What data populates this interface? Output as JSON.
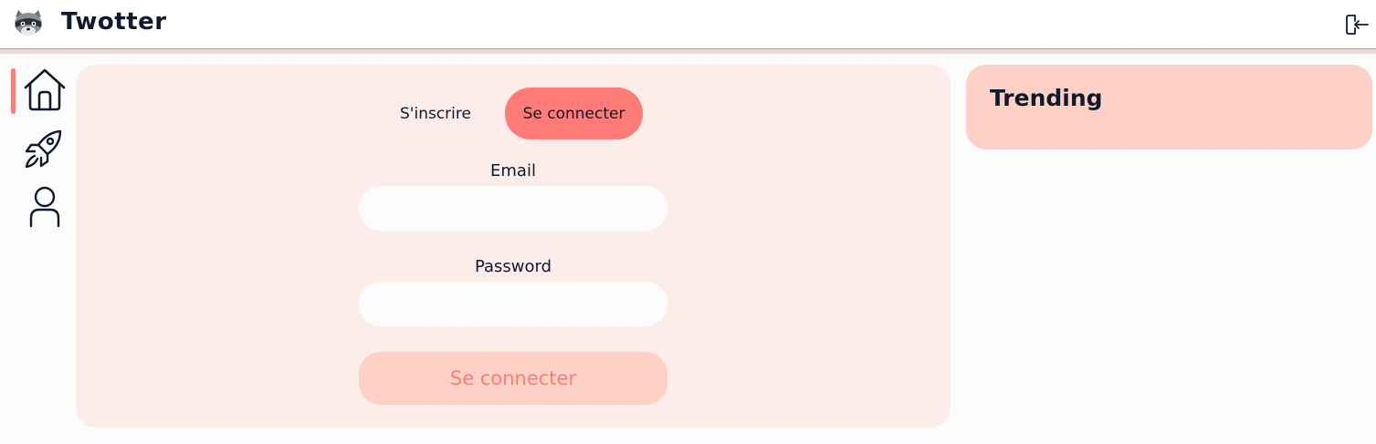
{
  "app": {
    "title": "Twotter",
    "logo_icon": "raccoon-icon",
    "logout_icon": "logout-icon"
  },
  "nav": {
    "items": [
      {
        "name": "home",
        "icon": "home-icon",
        "active": true
      },
      {
        "name": "explore",
        "icon": "rocket-icon",
        "active": false
      },
      {
        "name": "profile",
        "icon": "user-icon",
        "active": false
      }
    ]
  },
  "auth": {
    "tabs": {
      "signup_label": "S'inscrire",
      "login_label": "Se connecter",
      "active": "login"
    },
    "email": {
      "label": "Email",
      "value": "",
      "placeholder": ""
    },
    "password": {
      "label": "Password",
      "value": "",
      "placeholder": ""
    },
    "submit_label": "Se connecter"
  },
  "trending": {
    "title": "Trending"
  },
  "colors": {
    "accent": "#ff7b78",
    "panel_bg": "#fcecea",
    "card_bg": "#fdd1c5",
    "text": "#0f1b2d"
  }
}
